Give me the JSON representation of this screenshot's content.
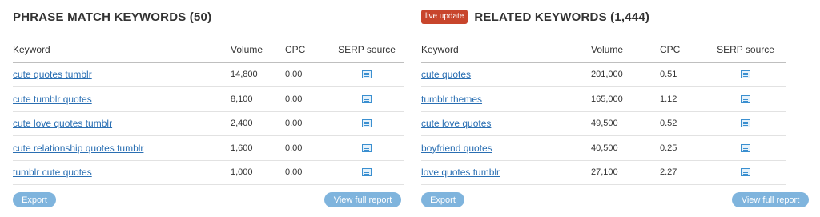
{
  "left": {
    "title": "PHRASE MATCH KEYWORDS (50)",
    "columns": [
      "Keyword",
      "Volume",
      "CPC",
      "SERP source"
    ],
    "rows": [
      {
        "keyword": "cute quotes tumblr",
        "volume": "14,800",
        "cpc": "0.00"
      },
      {
        "keyword": "cute tumblr quotes",
        "volume": "8,100",
        "cpc": "0.00"
      },
      {
        "keyword": "cute love quotes tumblr",
        "volume": "2,400",
        "cpc": "0.00"
      },
      {
        "keyword": "cute relationship quotes tumblr",
        "volume": "1,600",
        "cpc": "0.00"
      },
      {
        "keyword": "tumblr cute quotes",
        "volume": "1,000",
        "cpc": "0.00"
      }
    ],
    "export_label": "Export",
    "full_report_label": "View full report"
  },
  "right": {
    "badge": "live update",
    "title": "RELATED KEYWORDS (1,444)",
    "columns": [
      "Keyword",
      "Volume",
      "CPC",
      "SERP source"
    ],
    "rows": [
      {
        "keyword": "cute quotes",
        "volume": "201,000",
        "cpc": "0.51"
      },
      {
        "keyword": "tumblr themes",
        "volume": "165,000",
        "cpc": "1.12"
      },
      {
        "keyword": "cute love quotes",
        "volume": "49,500",
        "cpc": "0.52"
      },
      {
        "keyword": "boyfriend quotes",
        "volume": "40,500",
        "cpc": "0.25"
      },
      {
        "keyword": "love quotes tumblr",
        "volume": "27,100",
        "cpc": "2.27"
      }
    ],
    "export_label": "Export",
    "full_report_label": "View full report"
  },
  "colors": {
    "link": "#2a6fb3",
    "button": "#7fb4dd",
    "badge": "#c8452c",
    "serp_icon": "#3a8fd0"
  },
  "icons": {
    "serp_source": "serp-document-icon"
  }
}
